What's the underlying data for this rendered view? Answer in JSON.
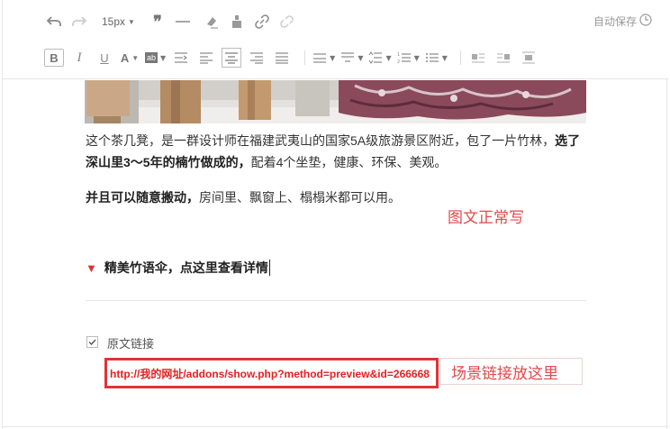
{
  "toolbar": {
    "font_size": "15px",
    "autosave_label": "自动保存"
  },
  "content": {
    "para1_a": "这个茶几凳，是一群设计师在福建武夷山的国家5A级旅游景区附近，包了一片竹林，",
    "para1_bold": "选了深山里3～5年的楠竹做成的，",
    "para1_b": "配着4个坐垫，健康、环保、美观。",
    "para2_bold": "并且可以随意搬动，",
    "para2_b": "房间里、飘窗上、榻榻米都可以用。",
    "note_image_text": "图文正常写",
    "detail_link": "精美竹语伞，点这里查看详情",
    "original_link_label": "原文链接",
    "original_link_url": "http://我的网址/addons/show.php?method=preview&id=266668",
    "note_link": "场景链接放这里"
  }
}
